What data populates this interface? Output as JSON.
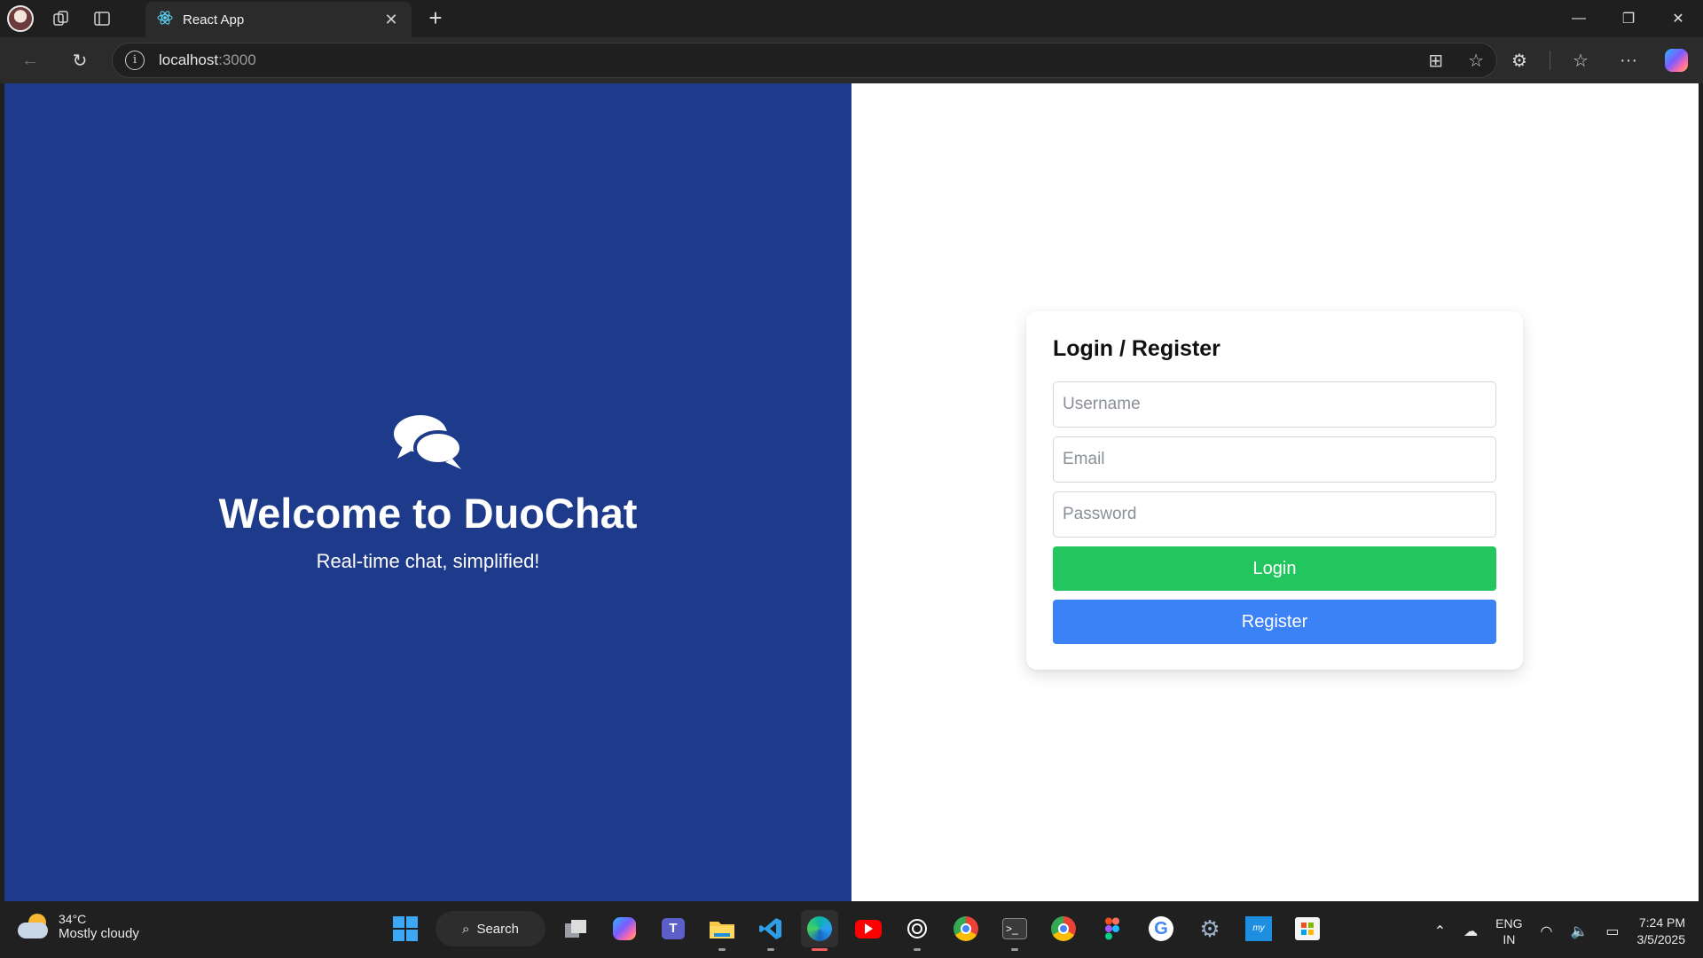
{
  "browser": {
    "tab_title": "React App",
    "url_host": "localhost",
    "url_port": ":3000"
  },
  "page": {
    "welcome_title": "Welcome to DuoChat",
    "tagline": "Real-time chat, simplified!",
    "form": {
      "heading": "Login / Register",
      "username_placeholder": "Username",
      "email_placeholder": "Email",
      "password_placeholder": "Password",
      "username_value": "",
      "email_value": "",
      "password_value": "",
      "login_label": "Login",
      "register_label": "Register"
    },
    "colors": {
      "left_panel": "#1e3a8a",
      "login_button": "#22c55e",
      "register_button": "#3b82f6"
    }
  },
  "taskbar": {
    "weather_temp": "34°C",
    "weather_desc": "Mostly cloudy",
    "search_label": "Search",
    "language": "ENG",
    "region": "IN",
    "time": "7:24 PM",
    "date": "3/5/2025",
    "apps": [
      "start",
      "search",
      "task-view",
      "copilot",
      "teams",
      "file-explorer",
      "vscode",
      "edge",
      "youtube",
      "chatgpt",
      "chrome",
      "terminal",
      "chrome-profile",
      "figma",
      "google",
      "settings",
      "myhp",
      "microsoft-store"
    ]
  }
}
